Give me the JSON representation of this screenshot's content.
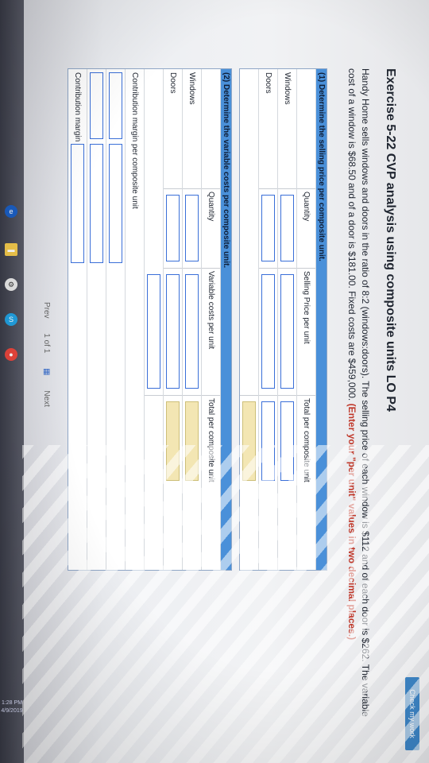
{
  "header": {
    "check_button": "Check my work",
    "title": "Exercise 5-22 CVP analysis using composite units LO P4"
  },
  "problem": {
    "text": "Handy Home sells windows and doors in the ratio of 8:2 (windows:doors). The selling price of each window is $112 and of each door is $262. The variable cost of a window is $68.50 and of a door is $181.00. Fixed costs are $459,000. ",
    "instruction": "(Enter your \"per unit\" values in two decimal places.)"
  },
  "part1": {
    "heading": "(1) Determine the selling price per composite unit.",
    "columns": [
      "Quantity",
      "Selling Price per unit",
      "Total per composite unit"
    ],
    "rows": [
      "Windows",
      "Doors"
    ]
  },
  "part2": {
    "heading": "(2) Determine the variable costs per composite unit.",
    "columns": [
      "Quantity",
      "Variable costs per unit",
      "Total per composite unit"
    ],
    "rows": [
      "Windows",
      "Doors"
    ],
    "cm_label": "Contribution margin per composite unit",
    "cm_row": "Contribution margin"
  },
  "pager": {
    "prev": "Prev",
    "page": "1 of 1",
    "next": "Next"
  },
  "taskbar": {
    "time": "1:28 PM",
    "date": "4/9/2019"
  },
  "colors": {
    "accent": "#4a90d9",
    "input_border": "#3a6fd8",
    "highlight_cell": "#f3e6b3",
    "instruction_red": "#c0392b"
  }
}
